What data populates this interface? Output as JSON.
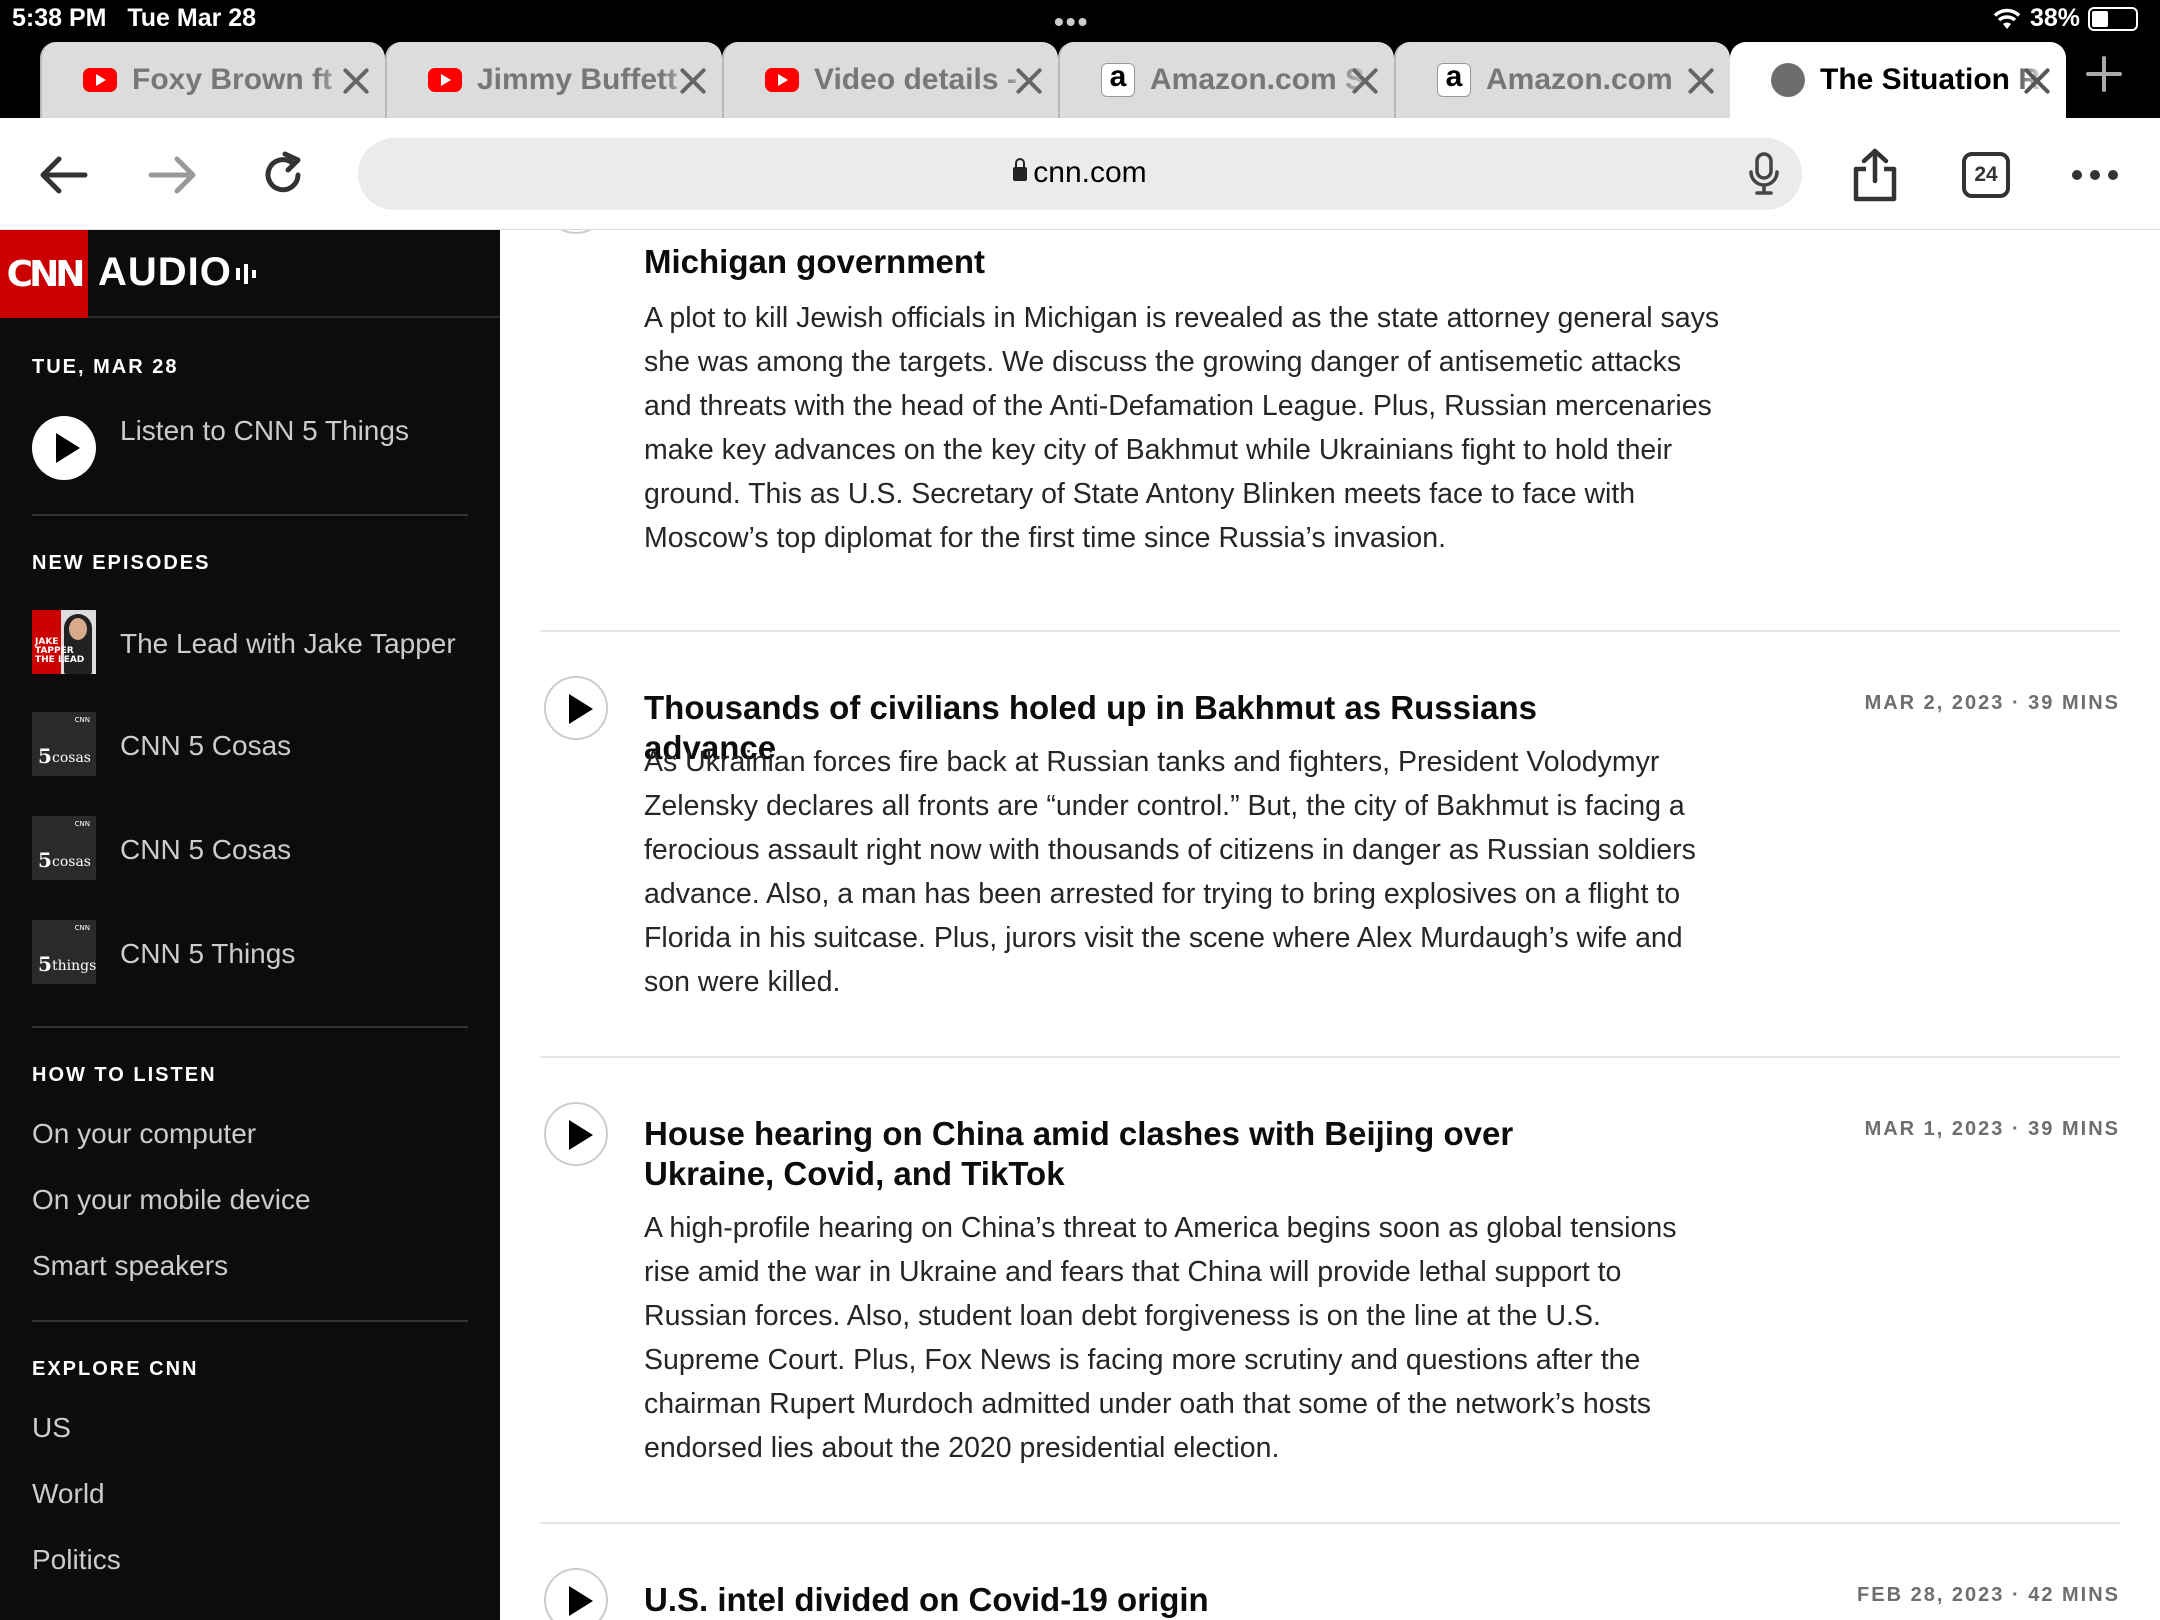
{
  "status": {
    "time": "5:38 PM",
    "date": "Tue Mar 28",
    "battery": "38%"
  },
  "tabs": [
    {
      "title": "Foxy Brown ft",
      "favicon": "youtube-icon"
    },
    {
      "title": "Jimmy Buffett",
      "favicon": "youtube-icon"
    },
    {
      "title": "Video details -",
      "favicon": "youtube-icon"
    },
    {
      "title": "Amazon.com S",
      "favicon": "amazon-icon"
    },
    {
      "title": "Amazon.com",
      "favicon": "amazon-icon"
    },
    {
      "title": "The Situation R",
      "favicon": "globe-icon"
    }
  ],
  "toolbar": {
    "url": "cnn.com",
    "tab_count": "24"
  },
  "sidebar": {
    "brand": {
      "logo": "CNN",
      "audio": "AUDIO"
    },
    "date_heading": "TUE, MAR 28",
    "listen_label": "Listen to CNN 5 Things",
    "new_episodes_heading": "NEW EPISODES",
    "new_episodes": [
      {
        "label": "The Lead with Jake Tapper"
      },
      {
        "label": "CNN 5 Cosas"
      },
      {
        "label": "CNN 5 Cosas"
      },
      {
        "label": "CNN 5 Things"
      }
    ],
    "thumb_text": {
      "lead": "JAKE TAPPER THE LEAD",
      "cosas_num": "5",
      "cosas_word": "cosas",
      "things_word": "things",
      "tiny": "CNN"
    },
    "how_to_listen_heading": "HOW TO LISTEN",
    "how_to_listen": [
      "On your computer",
      "On your mobile device",
      "Smart speakers"
    ],
    "explore_heading": "EXPLORE CNN",
    "explore": [
      "US",
      "World",
      "Politics"
    ]
  },
  "episodes": [
    {
      "title": "Michigan government",
      "meta": "",
      "description": "A plot to kill Jewish officials in Michigan is revealed as the state attorney general says she was among the targets. We discuss the growing danger of antisemetic attacks and threats with the head of the Anti-Defamation League. Plus, Russian mercenaries make key advances on the key city of Bakhmut while Ukrainians fight to hold their ground. This as U.S. Secretary of State Antony Blinken meets face to face with Moscow’s top diplomat for the first time since Russia’s invasion."
    },
    {
      "title": "Thousands of civilians holed up in Bakhmut as Russians advance",
      "meta": "MAR 2, 2023 · 39 MINS",
      "description": "As Ukrainian forces fire back at Russian tanks and fighters, President Volodymyr Zelensky declares all fronts are “under control.” But, the city of Bakhmut is facing a ferocious assault right now with thousands of citizens in danger as Russian soldiers advance. Also, a man has been arrested for trying to bring explosives on a flight to Florida in his suitcase. Plus, jurors visit the scene where Alex Murdaugh’s wife and son were killed."
    },
    {
      "title": "House hearing on China amid clashes with Beijing over Ukraine, Covid, and TikTok",
      "meta": "MAR 1, 2023 · 39 MINS",
      "description": "A high-profile hearing on China’s threat to America begins soon as global tensions rise amid the war in Ukraine and fears that China will provide lethal support to Russian forces. Also, student loan debt forgiveness is on the line at the U.S. Supreme Court. Plus, Fox News is facing more scrutiny and questions after the chairman Rupert Murdoch admitted under oath that some of the network’s hosts endorsed lies about the 2020 presidential election."
    },
    {
      "title": "U.S. intel divided on Covid-19 origin",
      "meta": "FEB 28, 2023 · 42 MINS",
      "description": ""
    }
  ]
}
